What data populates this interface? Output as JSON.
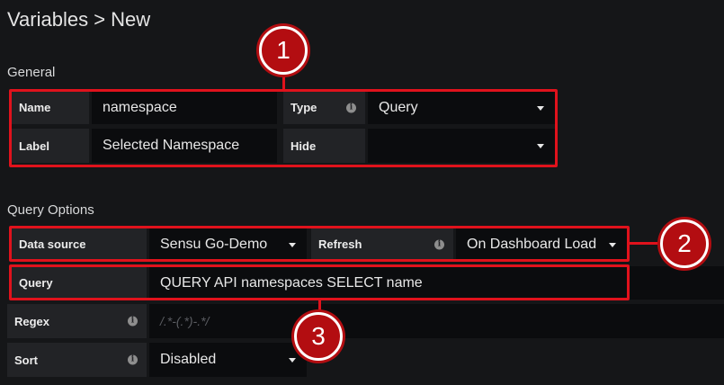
{
  "page": {
    "title": "Variables > New"
  },
  "general": {
    "heading": "General",
    "name": {
      "label": "Name",
      "value": "namespace"
    },
    "type": {
      "label": "Type",
      "value": "Query"
    },
    "label": {
      "label": "Label",
      "value": "Selected Namespace"
    },
    "hide": {
      "label": "Hide",
      "value": ""
    }
  },
  "query_options": {
    "heading": "Query Options",
    "data_source": {
      "label": "Data source",
      "value": "Sensu Go-Demo"
    },
    "refresh": {
      "label": "Refresh",
      "value": "On Dashboard Load"
    },
    "query": {
      "label": "Query",
      "value": "QUERY API namespaces SELECT name"
    },
    "regex": {
      "label": "Regex",
      "placeholder": "/.*-(.*)-.*/"
    },
    "sort": {
      "label": "Sort",
      "value": "Disabled"
    }
  },
  "callouts": [
    "1",
    "2",
    "3"
  ],
  "colors": {
    "annotation_red": "#e0121c",
    "background": "#151618",
    "label_bg": "#222326",
    "field_bg": "#0b0c0e"
  },
  "icons": {
    "info": "info-icon",
    "dropdown": "chevron-down-icon"
  }
}
